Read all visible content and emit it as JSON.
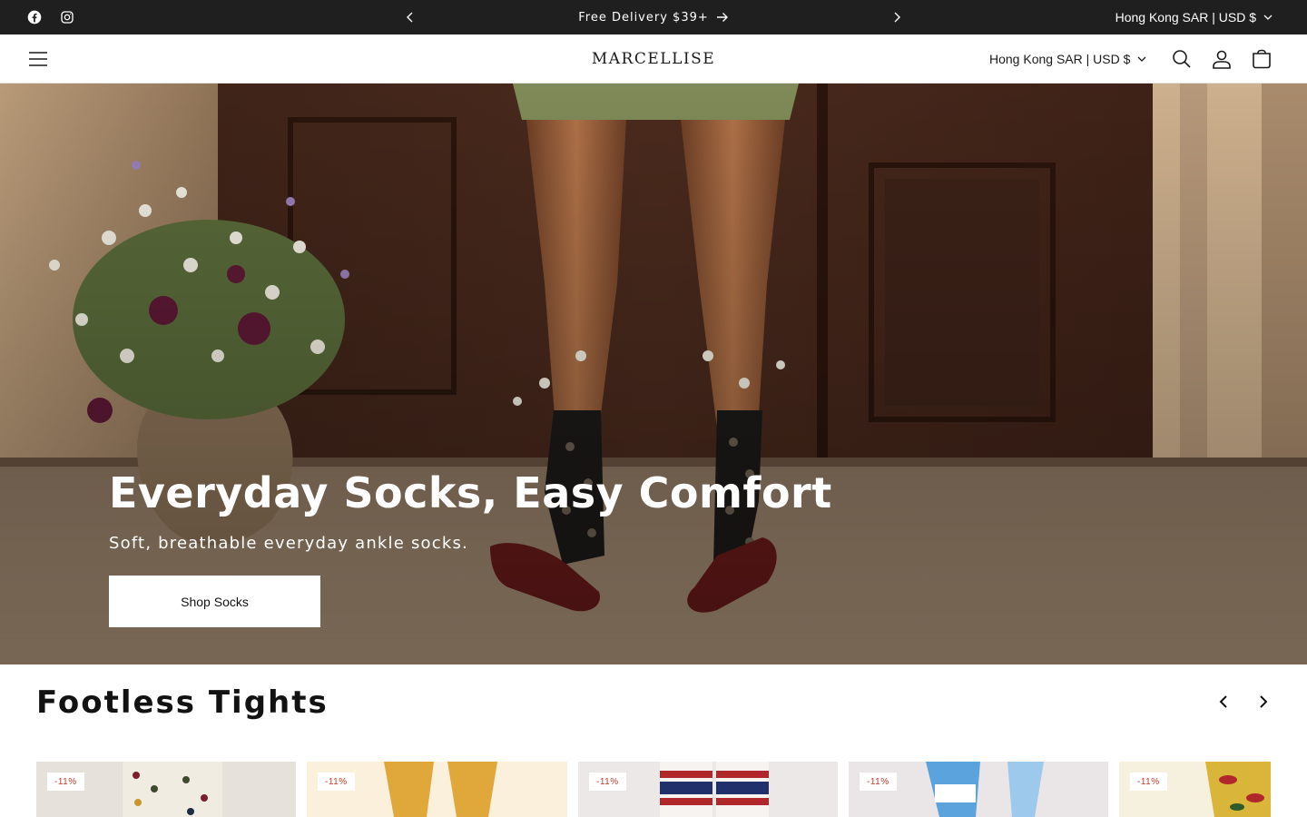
{
  "announcement": {
    "message": "Free Delivery $39+",
    "region_label": "Hong Kong SAR | USD $",
    "social_icons": [
      "facebook-icon",
      "instagram-icon"
    ]
  },
  "header": {
    "logo": "MARCELLISE",
    "region_label": "Hong Kong SAR | USD $",
    "icons": [
      "menu-icon",
      "search-icon",
      "account-icon",
      "cart-icon"
    ]
  },
  "hero": {
    "title": "Everyday Socks, Easy Comfort",
    "subtitle": "Soft, breathable everyday ankle socks.",
    "cta_label": "Shop Socks"
  },
  "collection": {
    "title": "Footless Tights",
    "products": [
      {
        "badge": "-11%"
      },
      {
        "badge": "-11%"
      },
      {
        "badge": "-11%"
      },
      {
        "badge": "-11%"
      },
      {
        "badge": "-11%"
      }
    ]
  },
  "colors": {
    "announcement_bg": "#1f1f1f",
    "sale_badge_text": "#c0392b",
    "button_bg": "#ffffff"
  }
}
